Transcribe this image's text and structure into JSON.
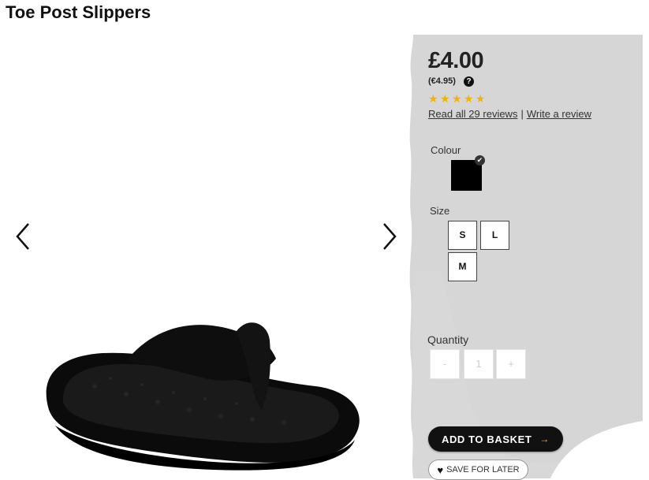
{
  "product": {
    "title": "Toe Post Slippers"
  },
  "gallery": {
    "prev_icon": "chevron-left-icon",
    "next_icon": "chevron-right-icon"
  },
  "pricing": {
    "price": "£4.00",
    "alt_price": "(€4.95)",
    "help_icon": "question-circle-icon",
    "help_symbol": "?"
  },
  "rating": {
    "value": 4.5,
    "max": 5,
    "read_reviews_label": "Read all 29 reviews",
    "separator": "|",
    "write_review_label": "Write a review"
  },
  "colour": {
    "label": "Colour",
    "selected_color": "#000000",
    "check_symbol": "✔"
  },
  "size": {
    "label": "Size",
    "options": [
      "S",
      "L",
      "M"
    ]
  },
  "quantity": {
    "label": "Quantity",
    "decrement": "-",
    "value": "1",
    "increment": "+"
  },
  "actions": {
    "add_to_basket_label": "ADD TO BASKET",
    "add_to_basket_arrow": "→",
    "save_for_later_label": "SAVE FOR LATER",
    "heart_symbol": "♥"
  },
  "colors": {
    "panel_bg": "#d6d6d6",
    "star": "#f3b100",
    "button_dark": "#111111",
    "accent_arrow": "#f3c300"
  }
}
